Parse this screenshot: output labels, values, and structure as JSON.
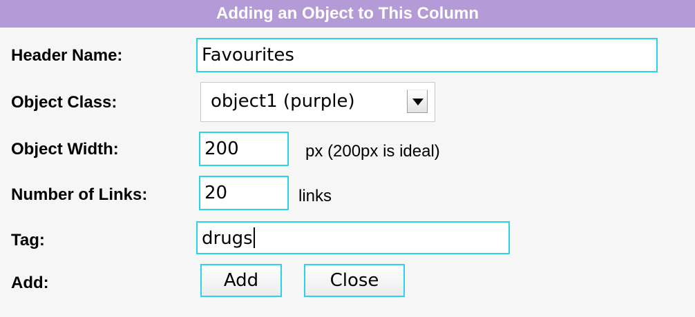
{
  "header": {
    "title": "Adding an Object to This Column",
    "bg_color": "#b59ad8"
  },
  "form": {
    "header_name": {
      "label": "Header Name:",
      "value": "Favourites"
    },
    "object_class": {
      "label": "Object Class:",
      "selected": "object1 (purple)",
      "icon": "chevron-down-icon"
    },
    "object_width": {
      "label": "Object Width:",
      "value": "200",
      "suffix": "px (200px is ideal)"
    },
    "number_of_links": {
      "label": "Number of Links:",
      "value": "20",
      "suffix": "links"
    },
    "tag": {
      "label": "Tag:",
      "value": "drugs"
    },
    "add": {
      "label": "Add:",
      "add_button": "Add",
      "close_button": "Close"
    }
  },
  "colors": {
    "field_border": "#2ad4e8",
    "background": "#f6f6f6"
  }
}
